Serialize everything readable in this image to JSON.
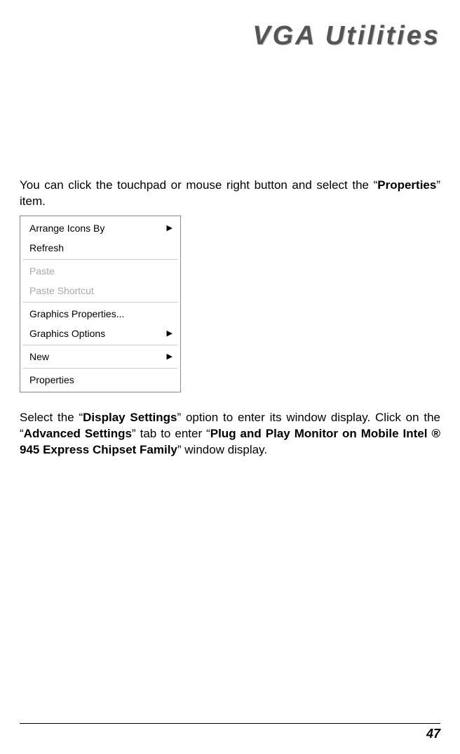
{
  "title": "VGA Utilities",
  "intro": {
    "pre": "You can click the touchpad or mouse right button and select the “",
    "bold": "Properties",
    "post": "” item."
  },
  "menu": {
    "items": [
      {
        "label": "Arrange Icons By",
        "disabled": false,
        "submenu": true
      },
      {
        "label": "Refresh",
        "disabled": false,
        "submenu": false
      },
      {
        "separator": true
      },
      {
        "label": "Paste",
        "disabled": true,
        "submenu": false
      },
      {
        "label": "Paste Shortcut",
        "disabled": true,
        "submenu": false
      },
      {
        "separator": true
      },
      {
        "label": "Graphics Properties...",
        "disabled": false,
        "submenu": false
      },
      {
        "label": "Graphics Options",
        "disabled": false,
        "submenu": true
      },
      {
        "separator": true
      },
      {
        "label": "New",
        "disabled": false,
        "submenu": true
      },
      {
        "separator": true
      },
      {
        "label": "Properties",
        "disabled": false,
        "submenu": false
      }
    ]
  },
  "body": {
    "p1_pre": "Select the “",
    "p1_b1": "Display Settings",
    "p1_mid1": "” option to enter its window display. Click on the “",
    "p1_b2": "Advanced Settings",
    "p1_mid2": "” tab to enter “",
    "p1_b3": "Plug and Play Monitor on Mobile Intel ® 945 Express Chipset Family",
    "p1_post": "” window display."
  },
  "arrow": "▶",
  "page_number": "47"
}
